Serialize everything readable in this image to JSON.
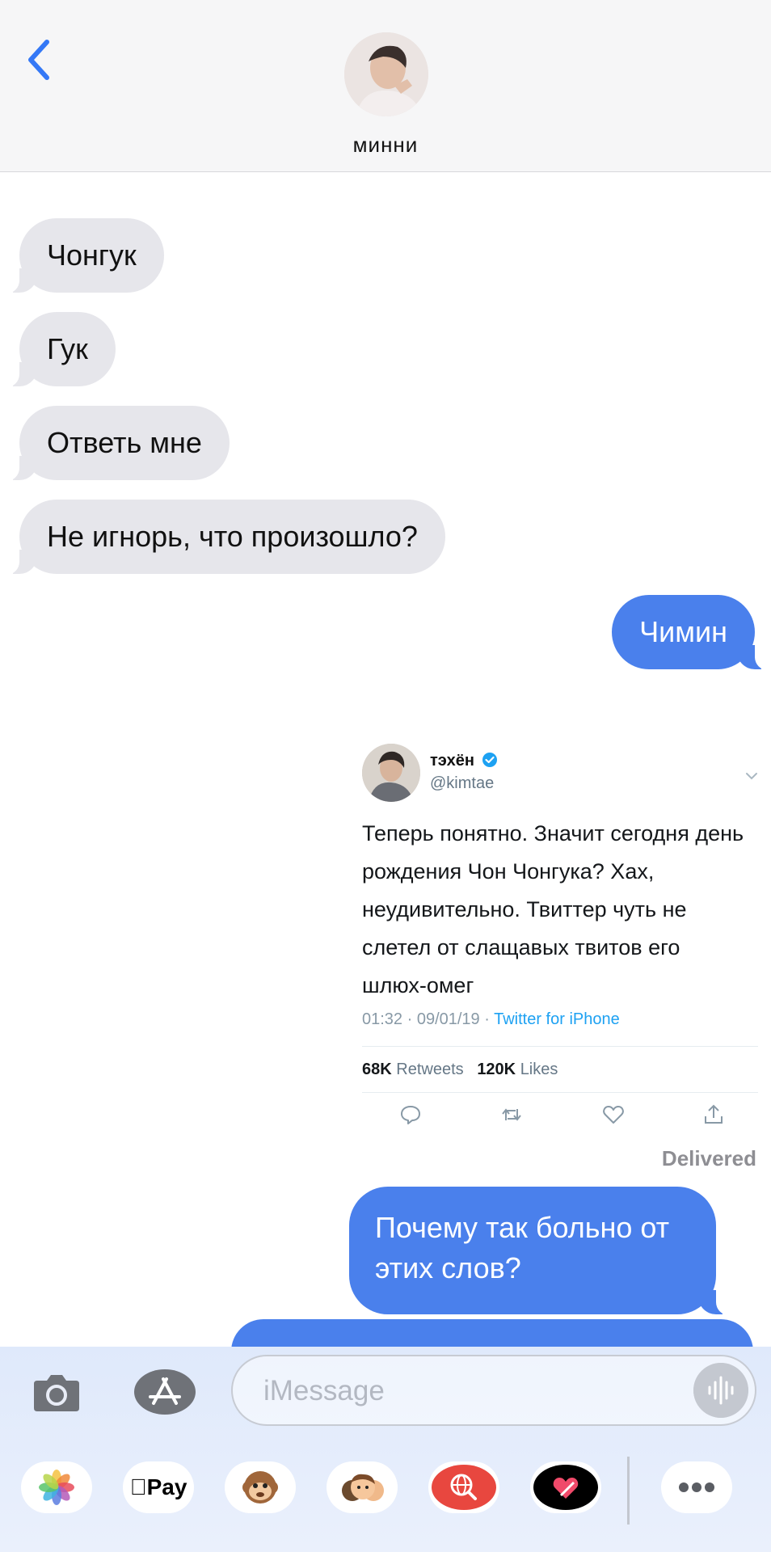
{
  "header": {
    "back_icon": "chevron-left-icon",
    "contact_name": "минни",
    "accent": "#3478f6"
  },
  "messages": [
    {
      "side": "incoming",
      "text": "Чонгук"
    },
    {
      "side": "incoming",
      "text": "Гук"
    },
    {
      "side": "incoming",
      "text": "Ответь мне"
    },
    {
      "side": "incoming",
      "text": "Не игнорь, что произошло?"
    },
    {
      "side": "outgoing",
      "text": "Чимин"
    },
    {
      "side": "outgoing",
      "text": "Почему так больно от этих слов?"
    }
  ],
  "tweet": {
    "name": "тэхён",
    "handle": "@kimtae",
    "text": "Теперь понятно. Значит сегодня день рождения Чон Чонгука? Хах, неудивительно. Твиттер чуть не слетел от слащавых твитов его шлюх-омег",
    "timestamp": "01:32 · 09/01/19 · ",
    "source": "Twitter for iPhone",
    "retweets_count": "68K",
    "retweets_label": "Retweets",
    "likes_count": "120K",
    "likes_label": "Likes"
  },
  "status": {
    "delivered": "Delivered"
  },
  "input": {
    "placeholder": "iMessage"
  },
  "dock": {
    "apple_pay_label": "Pay",
    "more_icon": "more-dots-icon"
  },
  "colors": {
    "incoming_bubble": "#e6e6eb",
    "outgoing_bubble": "#4a80ec",
    "twitter_blue": "#1da1f2"
  }
}
